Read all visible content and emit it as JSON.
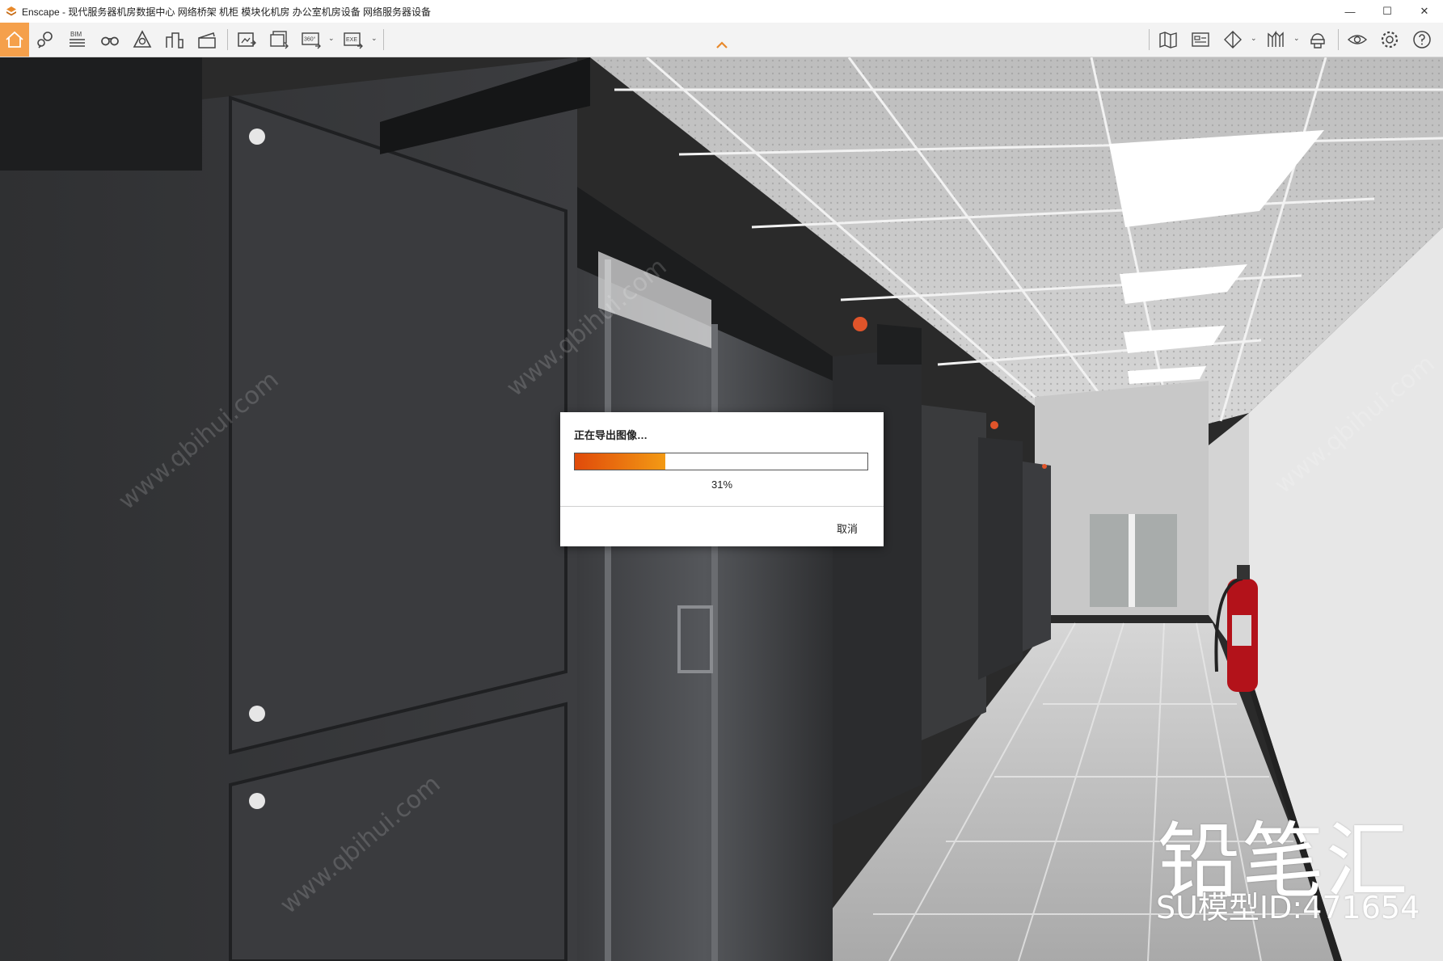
{
  "window": {
    "title": "Enscape - 现代服务器机房数据中心 网络桥架 机柜 模块化机房 办公室机房设备 网络服务器设备",
    "logo_icon": "enscape-logo-icon",
    "controls": {
      "minimize": "—",
      "maximize": "☐",
      "close": "✕"
    }
  },
  "toolbar": {
    "accent_color": "#f5a04b",
    "bim_label": "BIM",
    "panorama_label": "360°",
    "exe_label": "EXE",
    "left_icons": [
      "home-icon",
      "views-icon",
      "bim-icon",
      "binoculars-icon",
      "atmosphere-icon",
      "buildings-icon",
      "clapperboard-icon",
      "screenshot-icon",
      "batch-render-icon",
      "panorama-icon",
      "export-exe-icon"
    ],
    "right_icons": [
      "map-icon",
      "asset-library-icon",
      "material-icon",
      "section-icon",
      "upload-icon",
      "visual-settings-icon",
      "settings-icon",
      "help-icon"
    ]
  },
  "dialog": {
    "title": "正在导出图像…",
    "progress": 0.31,
    "percent_text": "31%",
    "cancel_label": "取消"
  },
  "watermark": {
    "brand": "铅笔汇",
    "model_id": "SU模型ID:471654",
    "site": "www.qbihui.com"
  }
}
